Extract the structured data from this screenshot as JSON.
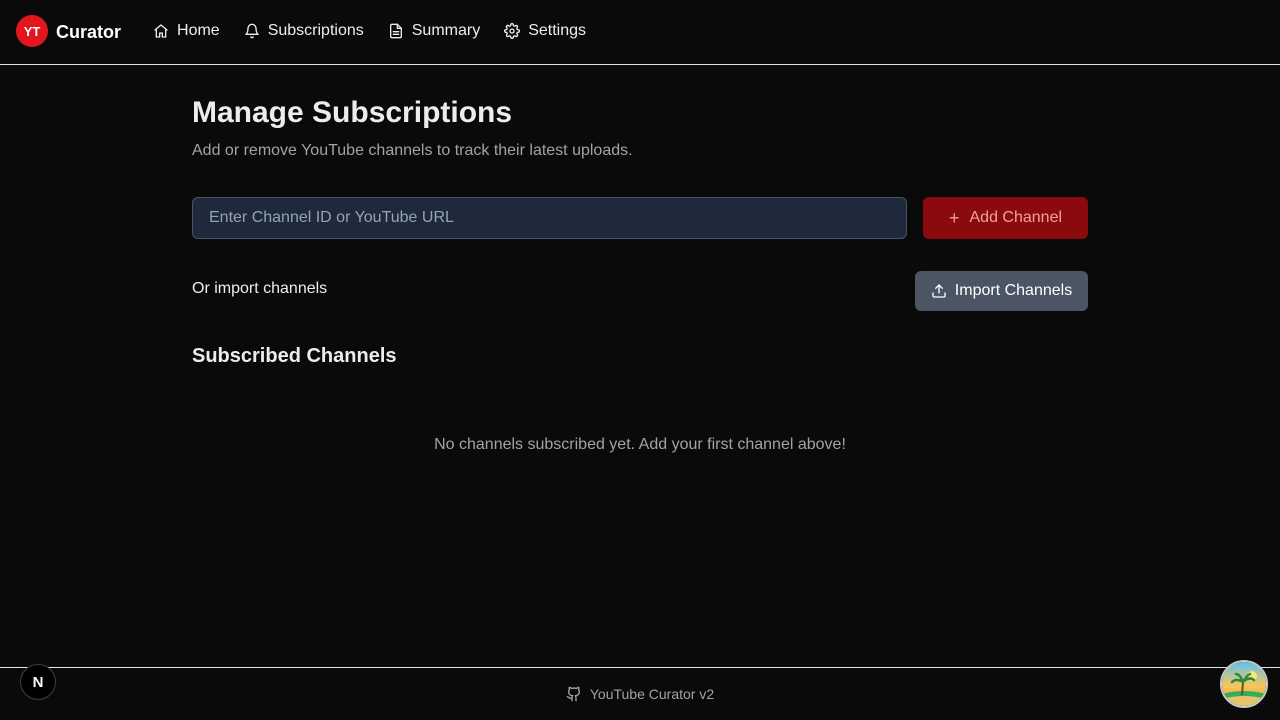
{
  "brand": {
    "logo_text": "YT",
    "name": "Curator"
  },
  "nav": {
    "items": [
      {
        "label": "Home",
        "icon": "home-icon"
      },
      {
        "label": "Subscriptions",
        "icon": "bell-icon"
      },
      {
        "label": "Summary",
        "icon": "document-icon"
      },
      {
        "label": "Settings",
        "icon": "gear-icon"
      }
    ]
  },
  "main": {
    "title": "Manage Subscriptions",
    "subtitle": "Add or remove YouTube channels to track their latest uploads.",
    "input_placeholder": "Enter Channel ID or YouTube URL",
    "add_button": "Add Channel",
    "import_label": "Or import channels",
    "import_button": "Import Channels",
    "section_title": "Subscribed Channels",
    "empty_message": "No channels subscribed yet. Add your first channel above!"
  },
  "footer": {
    "text": "YouTube Curator v2",
    "icon": "github-icon"
  },
  "badge": {
    "letter": "N"
  },
  "colors": {
    "background": "#0a0a0a",
    "brand_red": "#e2161b",
    "add_button": "#8b0a0d",
    "import_button": "#4b5563",
    "input_bg": "#1e293b"
  }
}
